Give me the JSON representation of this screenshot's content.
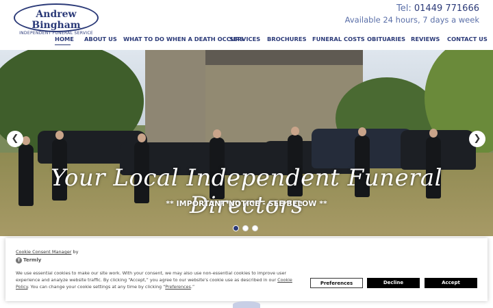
{
  "logo": {
    "name": "Andrew Bingham",
    "tagline": "INDEPENDENT FUNERAL SERVICE"
  },
  "contact": {
    "tel_label": "Tel:",
    "tel_number": "01449 771666",
    "availability": "Available 24 hours, 7 days a week"
  },
  "nav": {
    "items": [
      {
        "label": "HOME"
      },
      {
        "label": "ABOUT US"
      },
      {
        "label": "WHAT TO DO WHEN A DEATH OCCURS"
      },
      {
        "label": "SERVICES"
      },
      {
        "label": "BROCHURES"
      },
      {
        "label": "FUNERAL COSTS"
      },
      {
        "label": "OBITUARIES"
      },
      {
        "label": "REVIEWS"
      },
      {
        "label": "CONTACT US"
      }
    ],
    "active": "HOME"
  },
  "hero": {
    "title": "Your Local Independent Funeral Directors",
    "notice": "** IMPORTANT NOTICE - SEE BELOW **",
    "prev_icon": "chevron-left-icon",
    "next_icon": "chevron-right-icon",
    "slide_count": 3,
    "active_slide": 1
  },
  "cookie": {
    "manager_link": "Cookie Consent Manager",
    "by": "by",
    "brand": "Termly",
    "body_part1": "We use essential cookies to make our site work. With your consent, we may also use non-essential cookies to improve user experience and analyze website traffic. By clicking “Accept,” you agree to our website's cookie use as described in our ",
    "policy_link": "Cookie Policy",
    "body_part2": ". You can change your cookie settings at any time by clicking “",
    "preferences_link": "Preferences",
    "body_part3": ".”",
    "btn_preferences": "Preferences",
    "btn_decline": "Decline",
    "btn_accept": "Accept"
  },
  "colors": {
    "brand": "#2b3a78",
    "accent": "#5a6fa8"
  }
}
